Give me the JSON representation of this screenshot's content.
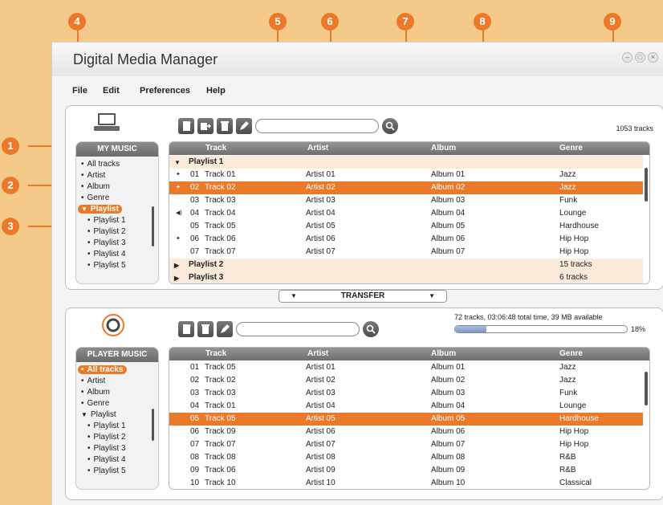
{
  "app": {
    "title": "Digital Media Manager",
    "window_controls": [
      "minimize",
      "maximize",
      "close"
    ]
  },
  "menu": [
    "File",
    "Edit",
    "Preferences",
    "Help"
  ],
  "callouts": [
    "1",
    "2",
    "3",
    "4",
    "5",
    "6",
    "7",
    "8",
    "9"
  ],
  "my_music": {
    "header": "MY MUSIC",
    "track_count": "1053 tracks",
    "nav": [
      {
        "label": "All tracks",
        "marker": "•",
        "selected": false
      },
      {
        "label": "Artist",
        "marker": "•",
        "selected": false
      },
      {
        "label": "Album",
        "marker": "•",
        "selected": false
      },
      {
        "label": "Genre",
        "marker": "•",
        "selected": false
      },
      {
        "label": "Playlist",
        "marker": "▼",
        "selected": true
      },
      {
        "label": "Playlist 1",
        "marker": "•",
        "selected": false,
        "sub": true
      },
      {
        "label": "Playlist 2",
        "marker": "•",
        "selected": false,
        "sub": true
      },
      {
        "label": "Playlist 3",
        "marker": "•",
        "selected": false,
        "sub": true
      },
      {
        "label": "Playlist 4",
        "marker": "•",
        "selected": false,
        "sub": true
      },
      {
        "label": "Playlist 5",
        "marker": "•",
        "selected": false,
        "sub": true
      }
    ],
    "columns": [
      "Track",
      "Artist",
      "Album",
      "Genre"
    ],
    "rows": [
      {
        "type": "group",
        "expanded": true,
        "name": "Playlist 1",
        "info": ""
      },
      {
        "marker": "✦",
        "num": "01",
        "track": "Track 01",
        "artist": "Artist 01",
        "album": "Album 01",
        "genre": "Jazz",
        "selected": false
      },
      {
        "marker": "✦",
        "num": "02",
        "track": "Track 02",
        "artist": "Artist 02",
        "album": "Album 02",
        "genre": "Jazz",
        "selected": true
      },
      {
        "marker": "",
        "num": "03",
        "track": "Track 03",
        "artist": "Artist 03",
        "album": "Album 03",
        "genre": "Funk",
        "selected": false
      },
      {
        "marker": "◀)",
        "num": "04",
        "track": "Track 04",
        "artist": "Artist 04",
        "album": "Album 04",
        "genre": "Lounge",
        "selected": false
      },
      {
        "marker": "",
        "num": "05",
        "track": "Track 05",
        "artist": "Artist 05",
        "album": "Album 05",
        "genre": "Hardhouse",
        "selected": false
      },
      {
        "marker": "✦",
        "num": "06",
        "track": "Track 06",
        "artist": "Artist 06",
        "album": "Album 06",
        "genre": "Hip Hop",
        "selected": false
      },
      {
        "marker": "",
        "num": "07",
        "track": "Track 07",
        "artist": "Artist 07",
        "album": "Album 07",
        "genre": "Hip Hop",
        "selected": false
      },
      {
        "type": "group",
        "expanded": false,
        "name": "Playlist 2",
        "info": "15 tracks"
      },
      {
        "type": "group",
        "expanded": false,
        "name": "Playlist 3",
        "info": "6 tracks"
      }
    ]
  },
  "transfer": {
    "label": "TRANSFER",
    "left_arrow": "▼",
    "right_arrow": "▼"
  },
  "player_music": {
    "header": "PLAYER MUSIC",
    "status": "72 tracks, 03:06:48 total time, 39 MB available",
    "capacity_percent_label": "18%",
    "capacity_used_fraction": 0.18,
    "nav": [
      {
        "label": "All tracks",
        "marker": "•",
        "selected": true
      },
      {
        "label": "Artist",
        "marker": "•",
        "selected": false
      },
      {
        "label": "Album",
        "marker": "•",
        "selected": false
      },
      {
        "label": "Genre",
        "marker": "•",
        "selected": false
      },
      {
        "label": "Playlist",
        "marker": "▼",
        "selected": false
      },
      {
        "label": "Playlist 1",
        "marker": "•",
        "selected": false,
        "sub": true
      },
      {
        "label": "Playlist 2",
        "marker": "•",
        "selected": false,
        "sub": true
      },
      {
        "label": "Playlist 3",
        "marker": "•",
        "selected": false,
        "sub": true
      },
      {
        "label": "Playlist 4",
        "marker": "•",
        "selected": false,
        "sub": true
      },
      {
        "label": "Playlist 5",
        "marker": "•",
        "selected": false,
        "sub": true
      }
    ],
    "columns": [
      "Track",
      "Artist",
      "Album",
      "Genre"
    ],
    "rows": [
      {
        "num": "01",
        "track": "Track 05",
        "artist": "Artist 01",
        "album": "Album 01",
        "genre": "Jazz",
        "selected": false
      },
      {
        "num": "02",
        "track": "Track 02",
        "artist": "Artist 02",
        "album": "Album 02",
        "genre": "Jazz",
        "selected": false
      },
      {
        "num": "03",
        "track": "Track 03",
        "artist": "Artist 03",
        "album": "Album 03",
        "genre": "Funk",
        "selected": false
      },
      {
        "num": "04",
        "track": "Track 01",
        "artist": "Artist 04",
        "album": "Album 04",
        "genre": "Lounge",
        "selected": false
      },
      {
        "num": "05",
        "track": "Track 05",
        "artist": "Artist 05",
        "album": "Album 05",
        "genre": "Hardhouse",
        "selected": true
      },
      {
        "num": "06",
        "track": "Track 09",
        "artist": "Artist 06",
        "album": "Album 06",
        "genre": "Hip Hop",
        "selected": false
      },
      {
        "num": "07",
        "track": "Track 07",
        "artist": "Artist 07",
        "album": "Album 07",
        "genre": "Hip Hop",
        "selected": false
      },
      {
        "num": "08",
        "track": "Track 08",
        "artist": "Artist 08",
        "album": "Album 08",
        "genre": "R&B",
        "selected": false
      },
      {
        "num": "09",
        "track": "Track 06",
        "artist": "Artist 09",
        "album": "Album 09",
        "genre": "R&B",
        "selected": false
      },
      {
        "num": "10",
        "track": "Track 10",
        "artist": "Artist 10",
        "album": "Album 10",
        "genre": "Classical",
        "selected": false
      }
    ]
  },
  "colors": {
    "accent": "#ea7a2a",
    "background": "#f5c98a",
    "header_gray": "#7a7a7a"
  }
}
